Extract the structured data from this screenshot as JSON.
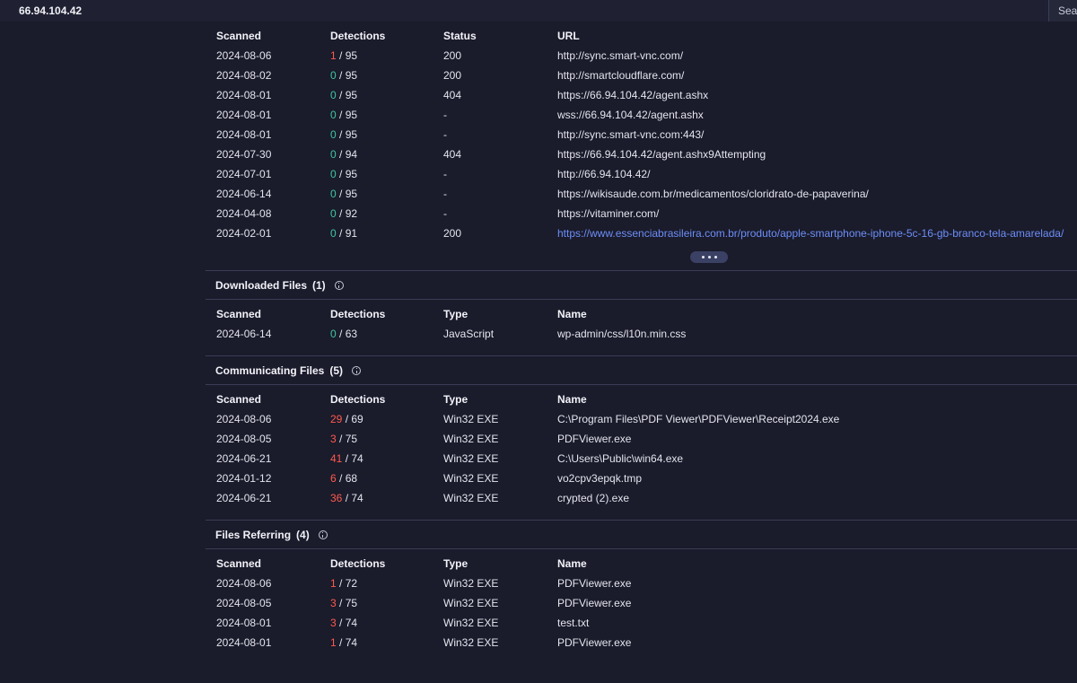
{
  "search": {
    "value": "66.94.104.42",
    "button_label": "Search"
  },
  "urls_table": {
    "headers": [
      "Scanned",
      "Detections",
      "Status",
      "URL"
    ],
    "rows": [
      {
        "scanned": "2024-08-06",
        "det": "1",
        "total": " / 95",
        "status": "200",
        "url": "http://sync.smart-vnc.com/"
      },
      {
        "scanned": "2024-08-02",
        "det": "0",
        "total": " / 95",
        "status": "200",
        "url": "http://smartcloudflare.com/"
      },
      {
        "scanned": "2024-08-01",
        "det": "0",
        "total": " / 95",
        "status": "404",
        "url": "https://66.94.104.42/agent.ashx"
      },
      {
        "scanned": "2024-08-01",
        "det": "0",
        "total": " / 95",
        "status": "-",
        "url": "wss://66.94.104.42/agent.ashx"
      },
      {
        "scanned": "2024-08-01",
        "det": "0",
        "total": " / 95",
        "status": "-",
        "url": "http://sync.smart-vnc.com:443/"
      },
      {
        "scanned": "2024-07-30",
        "det": "0",
        "total": " / 94",
        "status": "404",
        "url": "https://66.94.104.42/agent.ashx9Attempting"
      },
      {
        "scanned": "2024-07-01",
        "det": "0",
        "total": " / 95",
        "status": "-",
        "url": "http://66.94.104.42/"
      },
      {
        "scanned": "2024-06-14",
        "det": "0",
        "total": " / 95",
        "status": "-",
        "url": "https://wikisaude.com.br/medicamentos/cloridrato-de-papaverina/"
      },
      {
        "scanned": "2024-04-08",
        "det": "0",
        "total": " / 92",
        "status": "-",
        "url": "https://vitaminer.com/"
      },
      {
        "scanned": "2024-02-01",
        "det": "0",
        "total": " / 91",
        "status": "200",
        "url": "https://www.essenciabrasileira.com.br/produto/apple-smartphone-iphone-5c-16-gb-branco-tela-amarelada/"
      }
    ]
  },
  "downloaded": {
    "title": "Downloaded Files",
    "count": "(1)",
    "headers": [
      "Scanned",
      "Detections",
      "Type",
      "Name"
    ],
    "rows": [
      {
        "scanned": "2024-06-14",
        "det": "0",
        "total": " / 63",
        "type": "JavaScript",
        "name": "wp-admin/css/l10n.min.css"
      }
    ]
  },
  "communicating": {
    "title": "Communicating Files",
    "count": "(5)",
    "headers": [
      "Scanned",
      "Detections",
      "Type",
      "Name"
    ],
    "rows": [
      {
        "scanned": "2024-08-06",
        "det": "29",
        "total": " / 69",
        "type": "Win32 EXE",
        "name": "C:\\Program Files\\PDF Viewer\\PDFViewer\\Receipt2024.exe"
      },
      {
        "scanned": "2024-08-05",
        "det": "3",
        "total": " / 75",
        "type": "Win32 EXE",
        "name": "PDFViewer.exe"
      },
      {
        "scanned": "2024-06-21",
        "det": "41",
        "total": " / 74",
        "type": "Win32 EXE",
        "name": "C:\\Users\\Public\\win64.exe"
      },
      {
        "scanned": "2024-01-12",
        "det": "6",
        "total": " / 68",
        "type": "Win32 EXE",
        "name": "vo2cpv3epqk.tmp"
      },
      {
        "scanned": "2024-06-21",
        "det": "36",
        "total": " / 74",
        "type": "Win32 EXE",
        "name": "crypted (2).exe"
      }
    ]
  },
  "referring": {
    "title": "Files Referring",
    "count": "(4)",
    "headers": [
      "Scanned",
      "Detections",
      "Type",
      "Name"
    ],
    "rows": [
      {
        "scanned": "2024-08-06",
        "det": "1",
        "total": " / 72",
        "type": "Win32 EXE",
        "name": "PDFViewer.exe"
      },
      {
        "scanned": "2024-08-05",
        "det": "3",
        "total": " / 75",
        "type": "Win32 EXE",
        "name": "PDFViewer.exe"
      },
      {
        "scanned": "2024-08-01",
        "det": "3",
        "total": " / 74",
        "type": "Win32 EXE",
        "name": "test.txt"
      },
      {
        "scanned": "2024-08-01",
        "det": "1",
        "total": " / 74",
        "type": "Win32 EXE",
        "name": "PDFViewer.exe"
      }
    ]
  },
  "colors": {
    "positive": "#ff5a4e",
    "clean": "#3fc6a3",
    "link": "#6d8ef7"
  },
  "icons": {
    "info": "info-icon",
    "more": "ellipsis-icon"
  }
}
